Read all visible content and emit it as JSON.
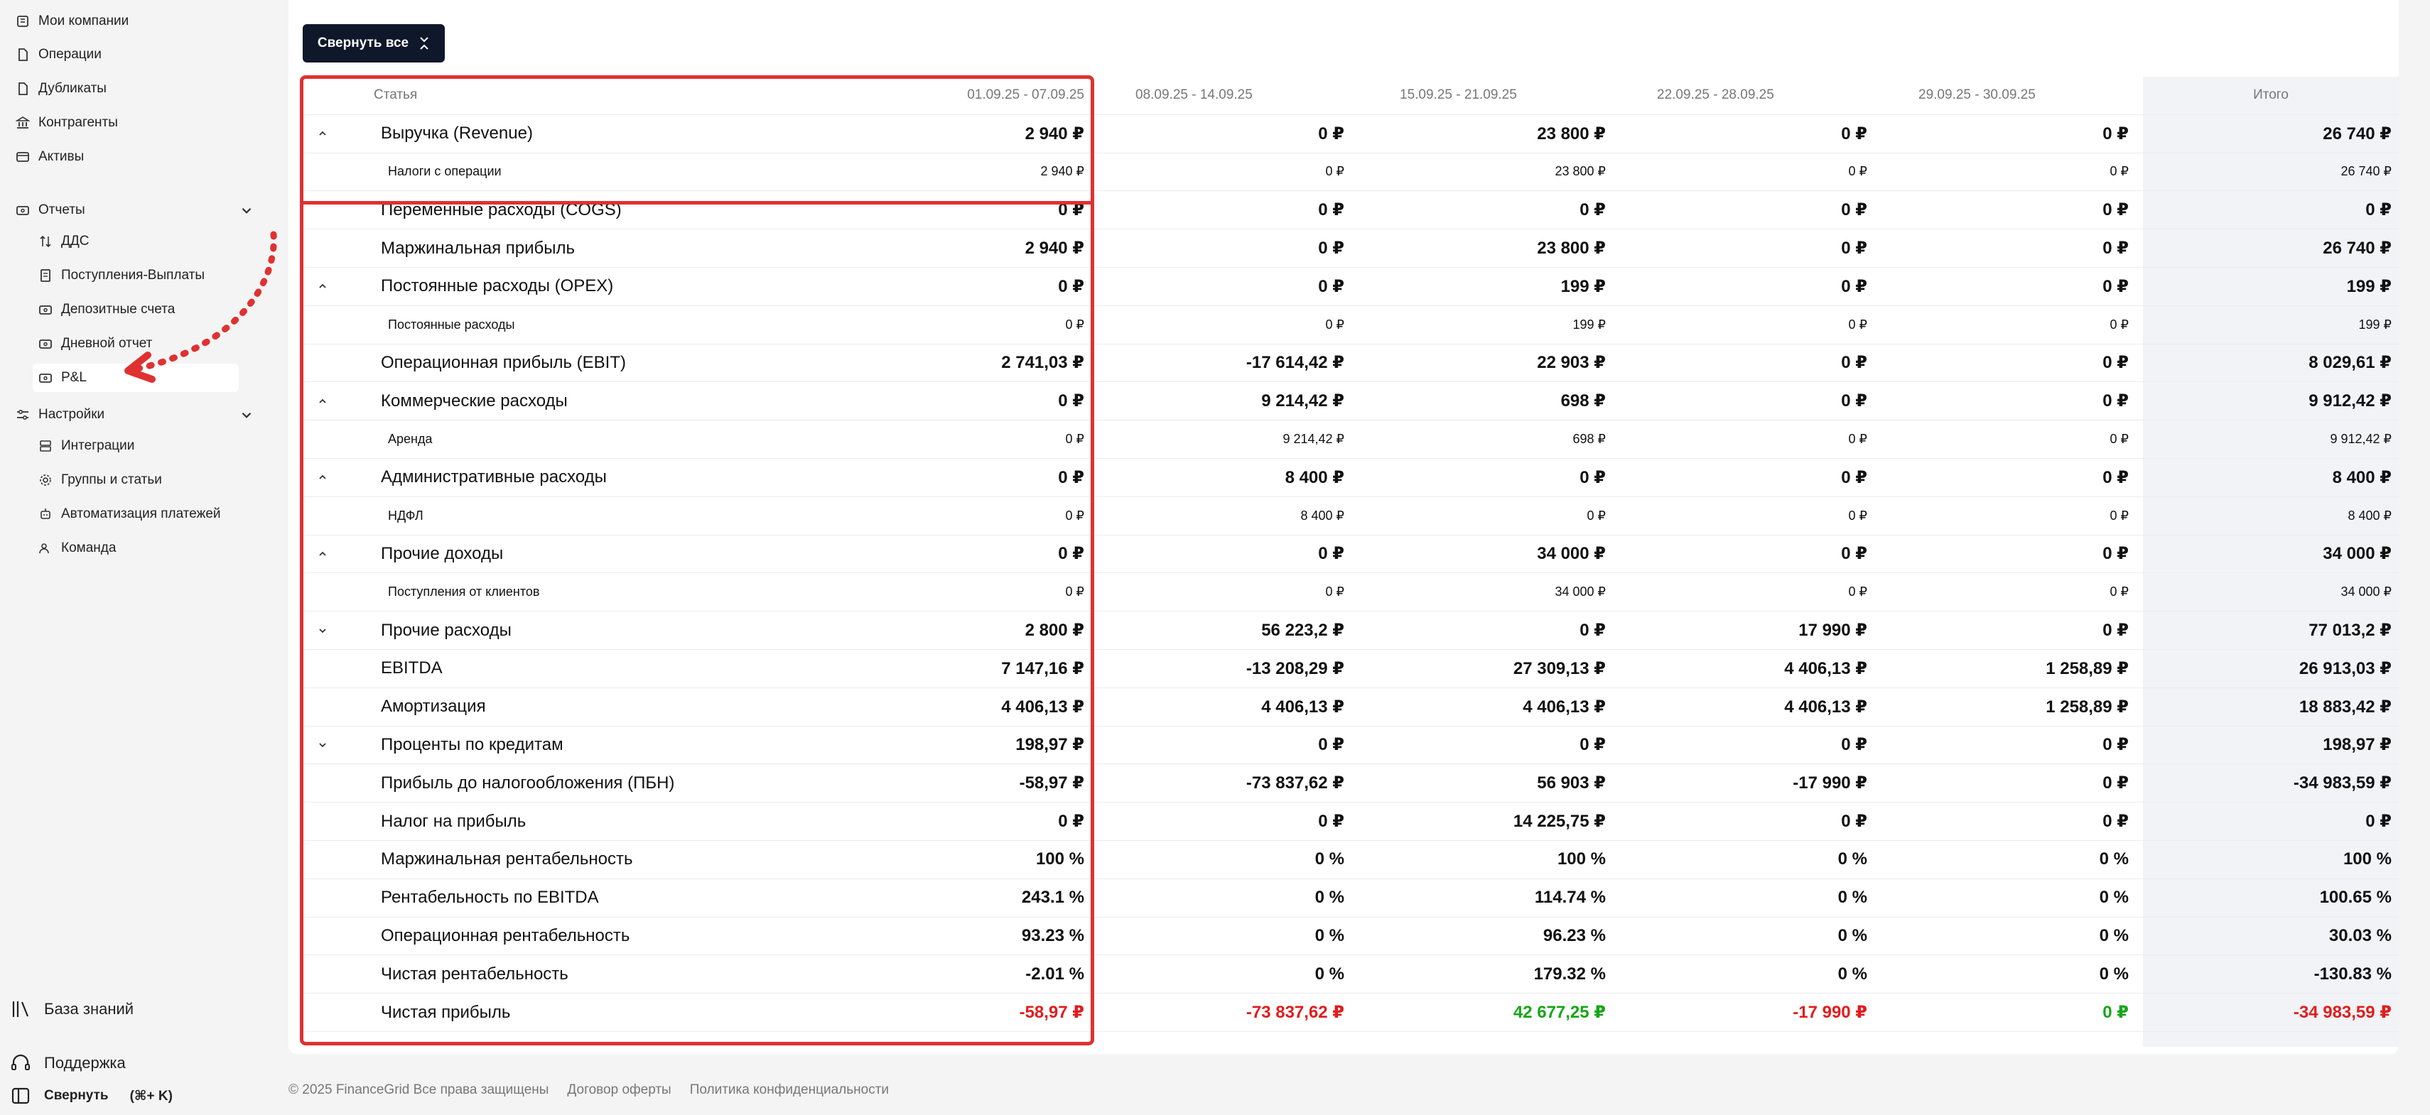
{
  "sidebar": {
    "top_items": [
      {
        "label": "Мои компании",
        "icon": "building-icon"
      },
      {
        "label": "Операции",
        "icon": "file-icon"
      },
      {
        "label": "Дубликаты",
        "icon": "file-icon"
      },
      {
        "label": "Контрагенты",
        "icon": "bank-icon"
      },
      {
        "label": "Активы",
        "icon": "wallet-icon"
      }
    ],
    "reports": {
      "label": "Отчеты",
      "items": [
        {
          "label": "ДДС",
          "icon": "arrows-icon"
        },
        {
          "label": "Поступления-Выплаты",
          "icon": "document-icon"
        },
        {
          "label": "Депозитные счета",
          "icon": "card-icon"
        },
        {
          "label": "Дневной отчет",
          "icon": "card-icon"
        },
        {
          "label": "P&L",
          "icon": "card-icon"
        }
      ]
    },
    "settings": {
      "label": "Настройки",
      "items": [
        {
          "label": "Интеграции",
          "icon": "database-icon"
        },
        {
          "label": "Группы и статьи",
          "icon": "gear-icon"
        },
        {
          "label": "Автоматизация платежей",
          "icon": "robot-icon"
        },
        {
          "label": "Команда",
          "icon": "users-icon"
        }
      ]
    },
    "knowledge": "База знаний",
    "support": "Поддержка",
    "collapse": "Свернуть",
    "collapse_shortcut": "(⌘+ K)"
  },
  "toolbar": {
    "collapse_all": "Свернуть все"
  },
  "table": {
    "headers": [
      "Статья",
      "01.09.25 - 07.09.25",
      "08.09.25 - 14.09.25",
      "15.09.25 - 21.09.25",
      "22.09.25 - 28.09.25",
      "29.09.25 - 30.09.25",
      "Итого"
    ],
    "rows": [
      {
        "label": "Выручка (Revenue)",
        "style": "bold",
        "toggle": "up",
        "values": [
          "2 940 ₽",
          "0 ₽",
          "23 800 ₽",
          "0 ₽",
          "0 ₽",
          "26 740 ₽"
        ]
      },
      {
        "label": "Налоги с операции",
        "style": "sm",
        "toggle": "",
        "values": [
          "2 940 ₽",
          "0 ₽",
          "23 800 ₽",
          "0 ₽",
          "0 ₽",
          "26 740 ₽"
        ]
      },
      {
        "label": "Переменные расходы (COGS)",
        "style": "bold",
        "toggle": "",
        "values": [
          "0 ₽",
          "0 ₽",
          "0 ₽",
          "0 ₽",
          "0 ₽",
          "0 ₽"
        ]
      },
      {
        "label": "Маржинальная прибыль",
        "style": "bold",
        "toggle": "",
        "values": [
          "2 940 ₽",
          "0 ₽",
          "23 800 ₽",
          "0 ₽",
          "0 ₽",
          "26 740 ₽"
        ]
      },
      {
        "label": "Постоянные расходы (OPEX)",
        "style": "bold",
        "toggle": "up",
        "values": [
          "0 ₽",
          "0 ₽",
          "199 ₽",
          "0 ₽",
          "0 ₽",
          "199 ₽"
        ]
      },
      {
        "label": "Постоянные расходы",
        "style": "sm",
        "toggle": "",
        "values": [
          "0 ₽",
          "0 ₽",
          "199 ₽",
          "0 ₽",
          "0 ₽",
          "199 ₽"
        ]
      },
      {
        "label": "Операционная прибыль (EBIT)",
        "style": "bold",
        "toggle": "",
        "values": [
          "2 741,03 ₽",
          "-17 614,42 ₽",
          "22 903 ₽",
          "0 ₽",
          "0 ₽",
          "8 029,61 ₽"
        ]
      },
      {
        "label": "Коммерческие расходы",
        "style": "bold",
        "toggle": "up",
        "values": [
          "0 ₽",
          "9 214,42 ₽",
          "698 ₽",
          "0 ₽",
          "0 ₽",
          "9 912,42 ₽"
        ]
      },
      {
        "label": "Аренда",
        "style": "sm",
        "toggle": "",
        "values": [
          "0 ₽",
          "9 214,42 ₽",
          "698 ₽",
          "0 ₽",
          "0 ₽",
          "9 912,42 ₽"
        ]
      },
      {
        "label": "Административные расходы",
        "style": "bold",
        "toggle": "up",
        "values": [
          "0 ₽",
          "8 400 ₽",
          "0 ₽",
          "0 ₽",
          "0 ₽",
          "8 400 ₽"
        ]
      },
      {
        "label": "НДФЛ",
        "style": "sm",
        "toggle": "",
        "values": [
          "0 ₽",
          "8 400 ₽",
          "0 ₽",
          "0 ₽",
          "0 ₽",
          "8 400 ₽"
        ]
      },
      {
        "label": "Прочие доходы",
        "style": "bold",
        "toggle": "up",
        "values": [
          "0 ₽",
          "0 ₽",
          "34 000 ₽",
          "0 ₽",
          "0 ₽",
          "34 000 ₽"
        ]
      },
      {
        "label": "Поступления от клиентов",
        "style": "sm",
        "toggle": "",
        "values": [
          "0 ₽",
          "0 ₽",
          "34 000 ₽",
          "0 ₽",
          "0 ₽",
          "34 000 ₽"
        ]
      },
      {
        "label": "Прочие расходы",
        "style": "bold",
        "toggle": "down",
        "values": [
          "2 800 ₽",
          "56 223,2 ₽",
          "0 ₽",
          "17 990 ₽",
          "0 ₽",
          "77 013,2 ₽"
        ]
      },
      {
        "label": "EBITDA",
        "style": "bold",
        "toggle": "",
        "values": [
          "7 147,16 ₽",
          "-13 208,29 ₽",
          "27 309,13 ₽",
          "4 406,13 ₽",
          "1 258,89 ₽",
          "26 913,03 ₽"
        ]
      },
      {
        "label": "Амортизация",
        "style": "bold",
        "toggle": "",
        "values": [
          "4 406,13 ₽",
          "4 406,13 ₽",
          "4 406,13 ₽",
          "4 406,13 ₽",
          "1 258,89 ₽",
          "18 883,42 ₽"
        ]
      },
      {
        "label": "Проценты по кредитам",
        "style": "bold",
        "toggle": "down",
        "values": [
          "198,97 ₽",
          "0 ₽",
          "0 ₽",
          "0 ₽",
          "0 ₽",
          "198,97 ₽"
        ]
      },
      {
        "label": "Прибыль до налогообложения (ПБН)",
        "style": "bold",
        "toggle": "",
        "values": [
          "-58,97 ₽",
          "-73 837,62 ₽",
          "56 903 ₽",
          "-17 990 ₽",
          "0 ₽",
          "-34 983,59 ₽"
        ]
      },
      {
        "label": "Налог на прибыль",
        "style": "bold",
        "toggle": "",
        "values": [
          "0 ₽",
          "0 ₽",
          "14 225,75 ₽",
          "0 ₽",
          "0 ₽",
          "0 ₽"
        ]
      },
      {
        "label": "Маржинальная рентабельность",
        "style": "bold",
        "toggle": "",
        "values": [
          "100 %",
          "0 %",
          "100 %",
          "0 %",
          "0 %",
          "100 %"
        ]
      },
      {
        "label": "Рентабельность по EBITDA",
        "style": "bold",
        "toggle": "",
        "values": [
          "243.1 %",
          "0 %",
          "114.74 %",
          "0 %",
          "0 %",
          "100.65 %"
        ]
      },
      {
        "label": "Операционная рентабельность",
        "style": "bold",
        "toggle": "",
        "values": [
          "93.23 %",
          "0 %",
          "96.23 %",
          "0 %",
          "0 %",
          "30.03 %"
        ]
      },
      {
        "label": "Чистая рентабельность",
        "style": "bold",
        "toggle": "",
        "values": [
          "-2.01 %",
          "0 %",
          "179.32 %",
          "0 %",
          "0 %",
          "-130.83 %"
        ]
      },
      {
        "label": "Чистая прибыль",
        "style": "bold",
        "toggle": "",
        "values": [
          "-58,97 ₽",
          "-73 837,62 ₽",
          "42 677,25 ₽",
          "-17 990 ₽",
          "0 ₽",
          "-34 983,59 ₽"
        ],
        "colors": [
          "neg",
          "neg",
          "pos",
          "neg",
          "pos",
          "neg"
        ]
      }
    ]
  },
  "footer": {
    "copyright": "© 2025 FinanceGrid Все права защищены",
    "offer": "Договор оферты",
    "privacy": "Политика конфиденциальности"
  },
  "colors": {
    "accent": "#0f172a",
    "highlight": "#e03131",
    "negative": "#e11d1d",
    "positive": "#17a617"
  }
}
